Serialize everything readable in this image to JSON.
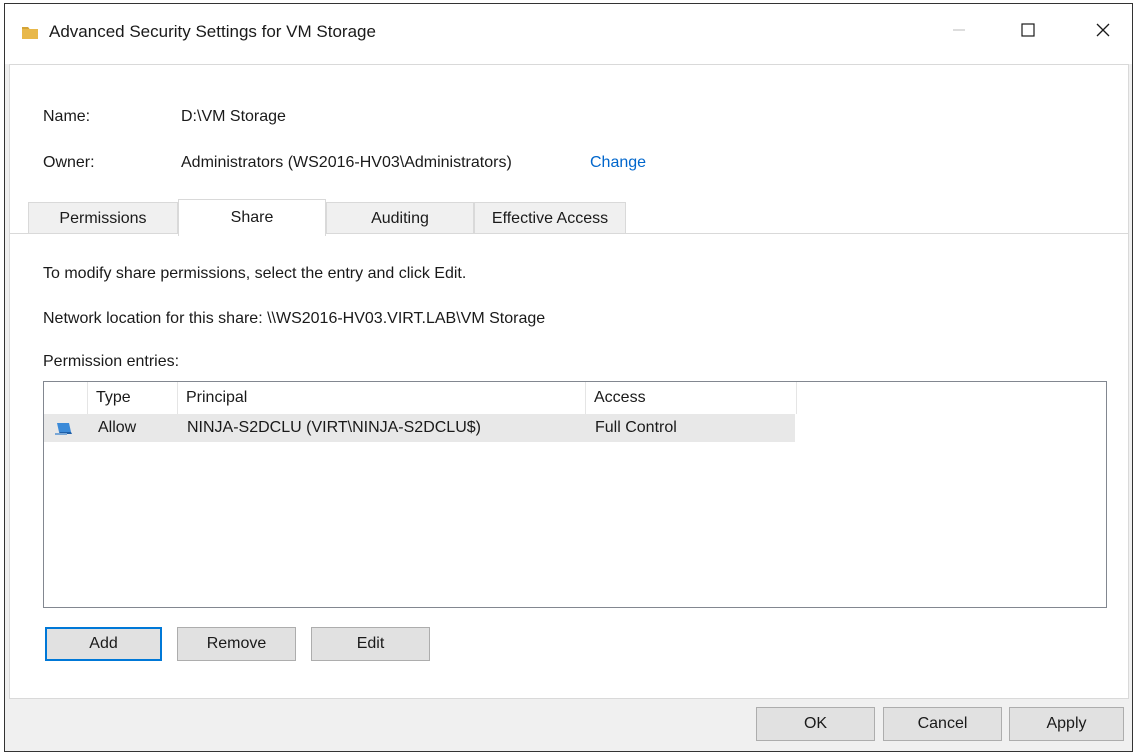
{
  "window": {
    "title": "Advanced Security Settings for VM Storage",
    "icon": "folder-icon",
    "controls": {
      "minimize": "minimize-icon",
      "maximize": "maximize-icon",
      "close": "close-icon"
    }
  },
  "info": {
    "name_label": "Name:",
    "name_value": "D:\\VM Storage",
    "owner_label": "Owner:",
    "owner_value": "Administrators (WS2016-HV03\\Administrators)",
    "change_link": "Change"
  },
  "tabs": [
    {
      "label": "Permissions",
      "selected": false
    },
    {
      "label": "Share",
      "selected": true
    },
    {
      "label": "Auditing",
      "selected": false
    },
    {
      "label": "Effective Access",
      "selected": false
    }
  ],
  "share": {
    "instruction": "To modify share permissions, select the entry and click Edit.",
    "network_location": "Network location for this share:  \\\\WS2016-HV03.VIRT.LAB\\VM Storage",
    "entries_label": "Permission entries:",
    "columns": [
      "Type",
      "Principal",
      "Access"
    ],
    "rows": [
      {
        "icon": "user-group-icon",
        "type": "Allow",
        "principal": "NINJA-S2DCLU (VIRT\\NINJA-S2DCLU$)",
        "access": "Full Control"
      }
    ],
    "buttons": {
      "add": "Add",
      "remove": "Remove",
      "edit": "Edit"
    }
  },
  "footer": {
    "ok": "OK",
    "cancel": "Cancel",
    "apply": "Apply"
  },
  "colors": {
    "link": "#0066cc",
    "default_button_border": "#0078d7",
    "folder": "#e8b84a"
  }
}
